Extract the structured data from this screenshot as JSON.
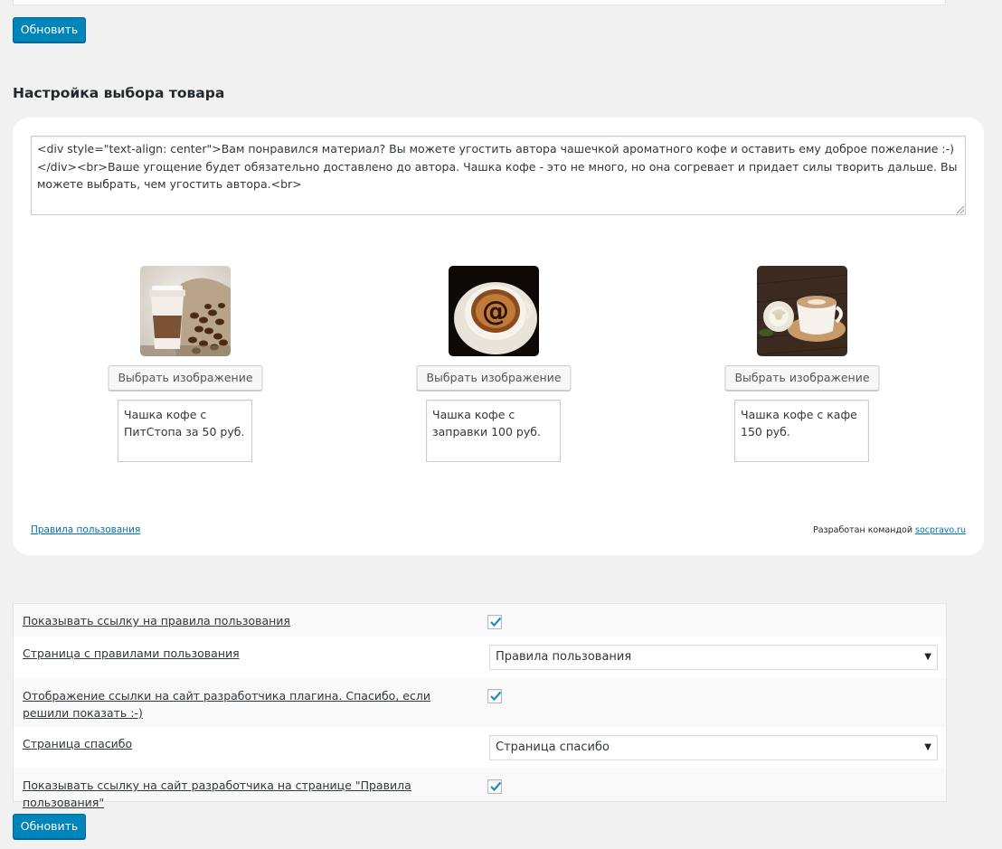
{
  "buttons": {
    "update_top": "Обновить",
    "update_bottom": "Обновить"
  },
  "product_section": {
    "title": "Настройка выбора товара",
    "intro_html": "<div style=\"text-align: center\">Вам понравился материал? Вы можете угостить автора чашечкой ароматного кофе и оставить ему доброе пожелание :-)</div><br>Ваше угощение будет обязательно доставлено до автора. Чашка кофе - это не много, но она согревает и придает силы творить дальше. Вы можете выбрать, чем угостить автора.<br>",
    "products": [
      {
        "image": "takeaway-coffee-cup-with-beans",
        "select_label": "Выбрать изображение",
        "caption": "Чашка кофе с ПитСтопа за 50 руб."
      },
      {
        "image": "espresso-cup-with-at-sign",
        "select_label": "Выбрать изображение",
        "caption": "Чашка кофе с заправки 100 руб."
      },
      {
        "image": "latte-cup-with-white-rose",
        "select_label": "Выбрать изображение",
        "caption": "Чашка кофе с кафе 150 руб."
      }
    ],
    "terms_link": "Правила пользования",
    "credit_text": "Разработан командой ",
    "credit_link": "socpravo.ru"
  },
  "settings": [
    {
      "label": "Показывать ссылку на правила пользования",
      "type": "checkbox",
      "checked": true
    },
    {
      "label": "Страница с правилами пользования",
      "type": "select",
      "value": "Правила пользования"
    },
    {
      "label": "Отображение ссылки на сайт разработчика плагина. Спасибо, если решили показать :-)",
      "type": "checkbox",
      "checked": true
    },
    {
      "label": "Страница спасибо",
      "type": "select",
      "value": "Страница спасибо"
    },
    {
      "label": "Показывать ссылку на сайт разработчика на странице \"Правила пользования\"",
      "type": "checkbox",
      "checked": true
    }
  ],
  "colors": {
    "primary_button": "#0085ba",
    "link": "#0073aa",
    "checkmark": "#1e8cbe",
    "page_background": "#f1f1f1"
  }
}
